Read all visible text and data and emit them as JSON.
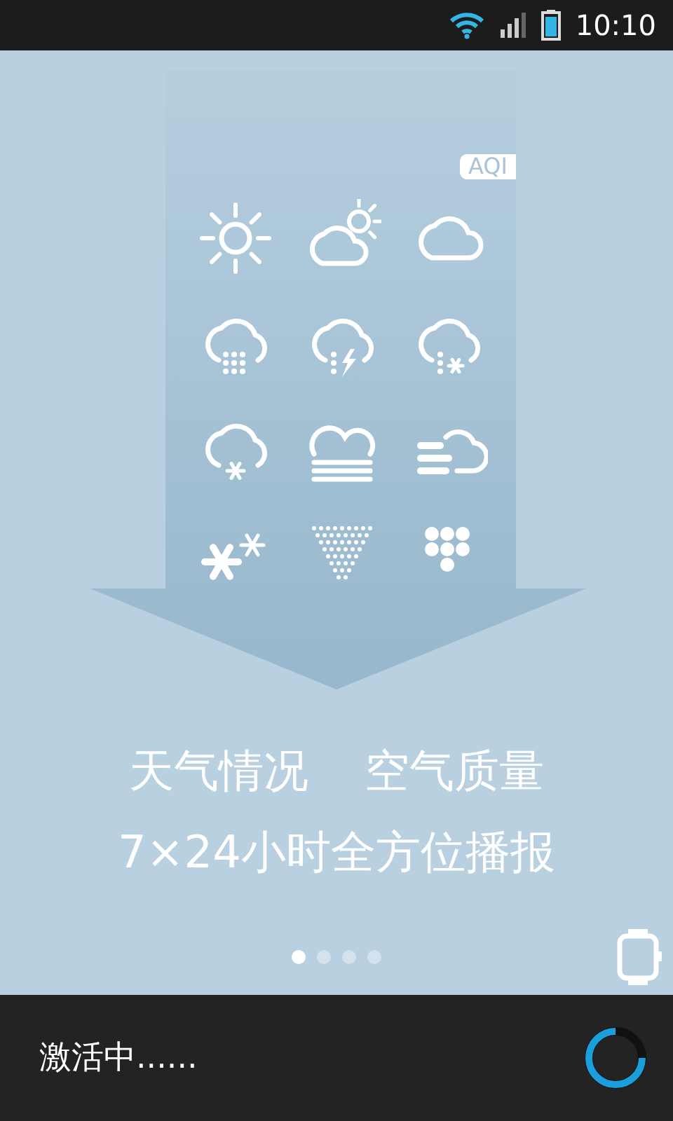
{
  "status_bar": {
    "time": "10:10"
  },
  "aqi_badge": "AQI",
  "headline": [
    "天气情况",
    "空气质量"
  ],
  "subheadline": "7×24小时全方位播报",
  "pager": [
    {
      "selected": true
    },
    {
      "selected": false
    },
    {
      "selected": false
    },
    {
      "selected": false
    }
  ],
  "footer": {
    "status": "激活中......"
  }
}
